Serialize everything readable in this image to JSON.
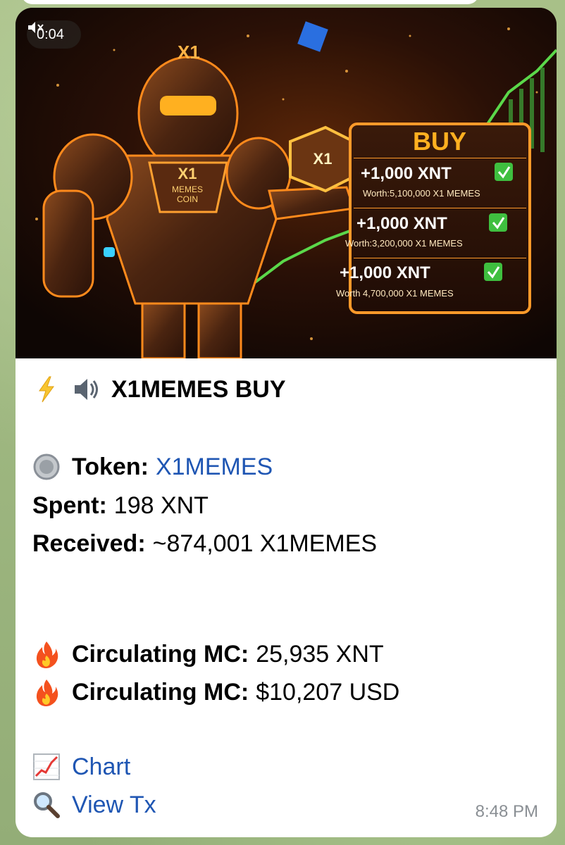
{
  "video": {
    "duration": "0:04"
  },
  "image_text": {
    "x1_helmet": "X1",
    "chest_line1": "X1",
    "chest_line2": "MEMES",
    "chest_line3": "COIN",
    "cube": "X1",
    "buy_title": "BUY",
    "orders": [
      {
        "amount": "+1,000 XNT",
        "worth": "Worth:5,100,000 X1 MEMES"
      },
      {
        "amount": "+1,000 XNT",
        "worth": "Worth:3,200,000 X1 MEMES"
      },
      {
        "amount": "+1,000 XNT",
        "worth": "Worth 4,700,000 X1 MEMES"
      }
    ]
  },
  "message": {
    "title": "X1MEMES BUY",
    "token_label": "Token:",
    "token_value": "X1MEMES",
    "spent_label": "Spent:",
    "spent_value": "198 XNT",
    "received_label": "Received:",
    "received_value": "~874,001 X1MEMES",
    "mc_label": "Circulating MC:",
    "mc_xnt": "25,935 XNT",
    "mc_usd": "$10,207 USD",
    "chart_link": "Chart",
    "tx_link": "View Tx",
    "time": "8:48 PM"
  },
  "colors": {
    "link": "#1f56b3",
    "timestamp": "#8a8f94",
    "accent_orange": "#ff8a1c",
    "check_green": "#3fbf3f"
  }
}
